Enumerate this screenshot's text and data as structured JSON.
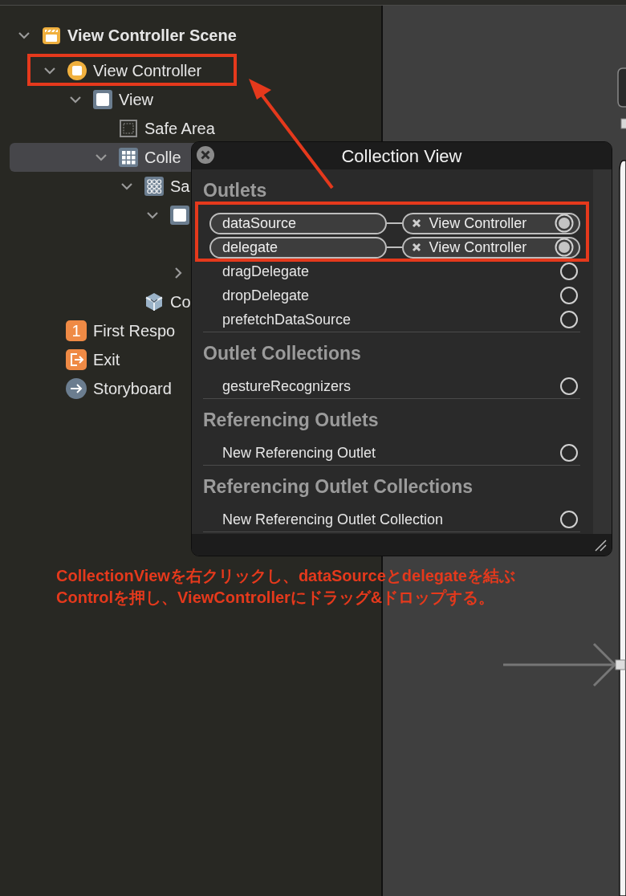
{
  "outline": [
    {
      "kind": "scene",
      "label": "View Controller Scene",
      "expanded": true,
      "selected": false,
      "children": [
        {
          "kind": "controller",
          "label": "View Controller",
          "expanded": true,
          "selected": false,
          "children": [
            {
              "kind": "view",
              "label": "View",
              "expanded": true,
              "selected": false,
              "children": [
                {
                  "kind": "safe-area",
                  "label": "Safe Area",
                  "selected": false
                },
                {
                  "kind": "collection",
                  "label": "Colle",
                  "expanded": true,
                  "selected": true,
                  "children": [
                    {
                      "kind": "cell",
                      "label": "Sa",
                      "expanded": true,
                      "selected": false,
                      "children": [
                        {
                          "kind": "view",
                          "expanded": true,
                          "selected": false,
                          "children": [
                            {
                              "selected": false
                            },
                            {
                              "expanded": false,
                              "selected": false
                            }
                          ]
                        }
                      ]
                    },
                    {
                      "kind": "layout",
                      "label": "Co",
                      "selected": false
                    }
                  ]
                }
              ]
            }
          ]
        },
        {
          "kind": "responder",
          "badge": "1",
          "label": "First Respo",
          "selected": false
        },
        {
          "kind": "exit",
          "label": "Exit",
          "selected": false
        },
        {
          "kind": "entry",
          "label": "Storyboard",
          "selected": false
        }
      ]
    }
  ],
  "connections_panel": {
    "title": "Collection View",
    "sections": [
      {
        "title": "Outlets",
        "items": [
          {
            "name": "dataSource",
            "connected": true,
            "target": "View Controller"
          },
          {
            "name": "delegate",
            "connected": true,
            "target": "View Controller"
          },
          {
            "name": "dragDelegate",
            "connected": false
          },
          {
            "name": "dropDelegate",
            "connected": false
          },
          {
            "name": "prefetchDataSource",
            "connected": false
          }
        ]
      },
      {
        "title": "Outlet Collections",
        "items": [
          {
            "name": "gestureRecognizers",
            "connected": false
          }
        ]
      },
      {
        "title": "Referencing Outlets",
        "items": [
          {
            "name": "New Referencing Outlet",
            "connected": false
          }
        ]
      },
      {
        "title": "Referencing Outlet Collections",
        "items": [
          {
            "name": "New Referencing Outlet Collection",
            "connected": false
          }
        ]
      }
    ]
  },
  "annotation": {
    "lines": [
      "CollectionViewを右クリックし、dataSourceとdelegateを結ぶ",
      "Controlを押し、ViewControllerにドラッグ&ドロップする。"
    ]
  }
}
